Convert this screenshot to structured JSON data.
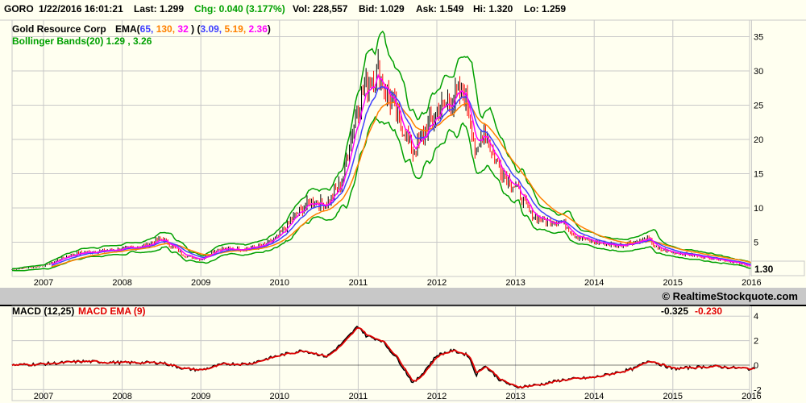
{
  "header": {
    "symbol": "GORO",
    "datetime": "1/22/2016 16:01:21",
    "last": "Last: 1.299",
    "chg": "Chg: 0.040 (3.177%)",
    "vol": "Vol: 228,557",
    "bid": "Bid: 1.029",
    "ask": "Ask: 1.549",
    "hi": "Hi: 1.320",
    "lo": "Lo: 1.259"
  },
  "legend": {
    "company": "Gold Resource Corp",
    "ema_label": "EMA(",
    "ema_p1": "65,",
    "ema_p2": "130,",
    "ema_p3": "32",
    "ema_close": ")",
    "ema_open2": "(",
    "ema_v1": "3.09,",
    "ema_v2": "5.19,",
    "ema_v3": "2.36",
    "ema_close2": ")",
    "bollinger": "Bollinger Bands(20) 1.29 , 3.26"
  },
  "last_price_box": "1.30",
  "copyright": "© RealtimeStockquote.com",
  "macd_legend": {
    "label": "MACD (12,25)",
    "signal_label": "MACD EMA (9)",
    "macd_value": "-0.325",
    "signal_value": "-0.230"
  },
  "colors": {
    "ema65": "#4040ff",
    "ema130": "#ff8000",
    "ema32": "#ff00ff",
    "bollinger": "#00a000",
    "up": "#000000",
    "down": "#ff0000",
    "macd": "#000000",
    "signal": "#e00000"
  },
  "chart_data": [
    {
      "type": "line",
      "title": "GORO price with EMA(65,130,32) and Bollinger Bands(20)",
      "x_ticks": [
        "2007",
        "2008",
        "2009",
        "2010",
        "2011",
        "2012",
        "2013",
        "2014",
        "2015",
        "2016"
      ],
      "y_ticks": [
        "5",
        "10",
        "15",
        "20",
        "25",
        "30",
        "35"
      ],
      "ylim": [
        0,
        35
      ],
      "x": [
        2006.6,
        2007.0,
        2007.3,
        2007.5,
        2008.0,
        2008.3,
        2008.5,
        2008.8,
        2009.0,
        2009.2,
        2009.5,
        2009.8,
        2010.0,
        2010.2,
        2010.4,
        2010.6,
        2010.8,
        2010.9,
        2011.0,
        2011.1,
        2011.25,
        2011.4,
        2011.5,
        2011.6,
        2011.7,
        2011.8,
        2012.0,
        2012.2,
        2012.35,
        2012.45,
        2012.5,
        2012.6,
        2012.7,
        2012.85,
        2013.0,
        2013.2,
        2013.4,
        2013.6,
        2013.75,
        2014.0,
        2014.3,
        2014.5,
        2014.7,
        2014.8,
        2015.0,
        2015.3,
        2015.6,
        2015.8,
        2016.05
      ],
      "close": [
        1.0,
        1.5,
        3.0,
        3.5,
        4.0,
        4.5,
        5.5,
        3.0,
        2.5,
        4.0,
        4.0,
        4.5,
        6.0,
        9.0,
        11.0,
        10.5,
        14.0,
        20.0,
        25.0,
        28.0,
        30.0,
        26.0,
        23.0,
        21.0,
        18.0,
        20.0,
        24.0,
        26.0,
        27.0,
        22.0,
        17.0,
        22.0,
        18.0,
        15.0,
        13.0,
        9.0,
        8.0,
        8.0,
        6.0,
        5.0,
        4.5,
        5.0,
        5.5,
        4.0,
        3.5,
        3.0,
        2.5,
        2.0,
        1.3
      ]
    },
    {
      "type": "line",
      "title": "MACD (12,25) / MACD EMA (9)",
      "y_ticks": [
        "-2",
        "0",
        "2",
        "4"
      ],
      "ylim": [
        -2.4,
        4.2
      ],
      "x": [
        2006.6,
        2007.0,
        2007.5,
        2008.0,
        2008.5,
        2008.8,
        2009.0,
        2009.3,
        2009.6,
        2010.0,
        2010.3,
        2010.6,
        2010.8,
        2011.0,
        2011.1,
        2011.3,
        2011.5,
        2011.7,
        2011.8,
        2012.0,
        2012.2,
        2012.4,
        2012.5,
        2012.6,
        2012.8,
        2013.0,
        2013.3,
        2013.6,
        2014.0,
        2014.5,
        2014.7,
        2015.0,
        2015.5,
        2016.05
      ],
      "macd": [
        0,
        0.1,
        0.3,
        0.2,
        0.2,
        -0.3,
        -0.4,
        0.1,
        0.1,
        0.8,
        1.2,
        0.7,
        1.8,
        3.2,
        2.4,
        2.0,
        0.5,
        -1.5,
        -0.8,
        0.8,
        1.2,
        0.8,
        -0.8,
        0.0,
        -1.2,
        -1.8,
        -1.6,
        -1.2,
        -1.0,
        -0.3,
        0.4,
        -0.3,
        -0.1,
        -0.33
      ]
    }
  ]
}
